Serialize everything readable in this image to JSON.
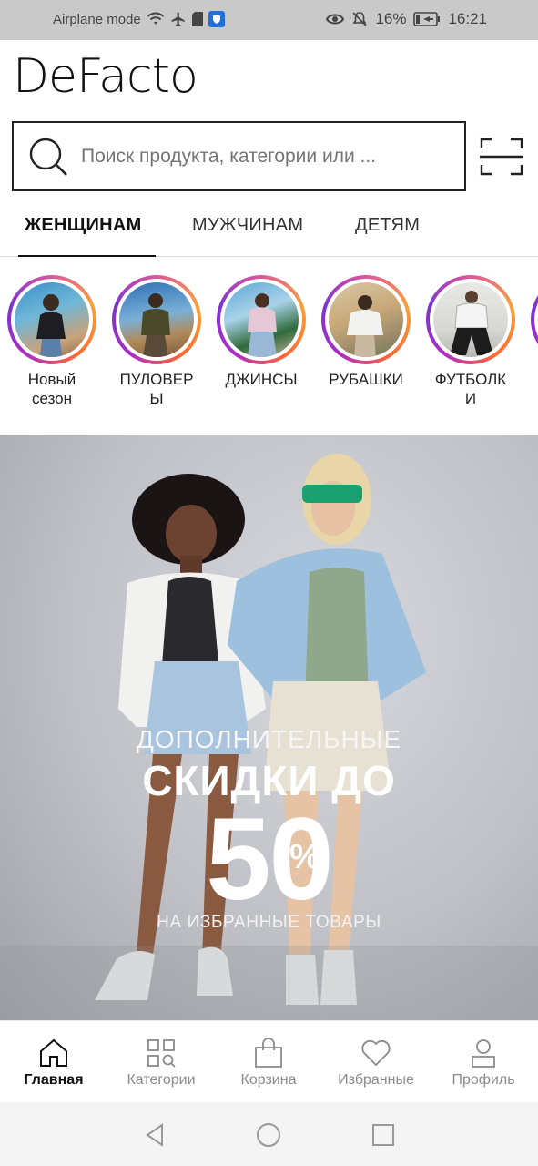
{
  "status_bar": {
    "left_text": "Airplane mode",
    "battery": "16%",
    "time": "16:21"
  },
  "header": {
    "logo": "DeFacto",
    "search_placeholder": "Поиск продукта, категории или ..."
  },
  "tabs": [
    {
      "label": "ЖЕНЩИНАМ",
      "active": true
    },
    {
      "label": "МУЖЧИНАМ",
      "active": false
    },
    {
      "label": "ДЕТЯМ",
      "active": false
    }
  ],
  "stories": [
    {
      "label": "Новый\nсезон"
    },
    {
      "label": "ПУЛОВЕР\nЫ"
    },
    {
      "label": "ДЖИНСЫ"
    },
    {
      "label": "РУБАШКИ"
    },
    {
      "label": "ФУТБОЛК\nИ"
    }
  ],
  "banner": {
    "line1": "ДОПОЛНИТЕЛЬНЫЕ",
    "line2": "СКИДКИ ДО",
    "number": "50",
    "percent": "%",
    "line4": "НА ИЗБРАННЫЕ ТОВАРЫ"
  },
  "bottom_nav": [
    {
      "label": "Главная",
      "icon": "home-icon",
      "active": true
    },
    {
      "label": "Категории",
      "icon": "categories-icon",
      "active": false
    },
    {
      "label": "Корзина",
      "icon": "cart-icon",
      "active": false
    },
    {
      "label": "Избранные",
      "icon": "heart-icon",
      "active": false
    },
    {
      "label": "Профиль",
      "icon": "profile-icon",
      "active": false
    }
  ],
  "colors": {
    "status_bar_bg": "#c9c9c9",
    "story_ring": "#c13584",
    "text_primary": "#111111",
    "text_muted": "#8b8b8b"
  }
}
